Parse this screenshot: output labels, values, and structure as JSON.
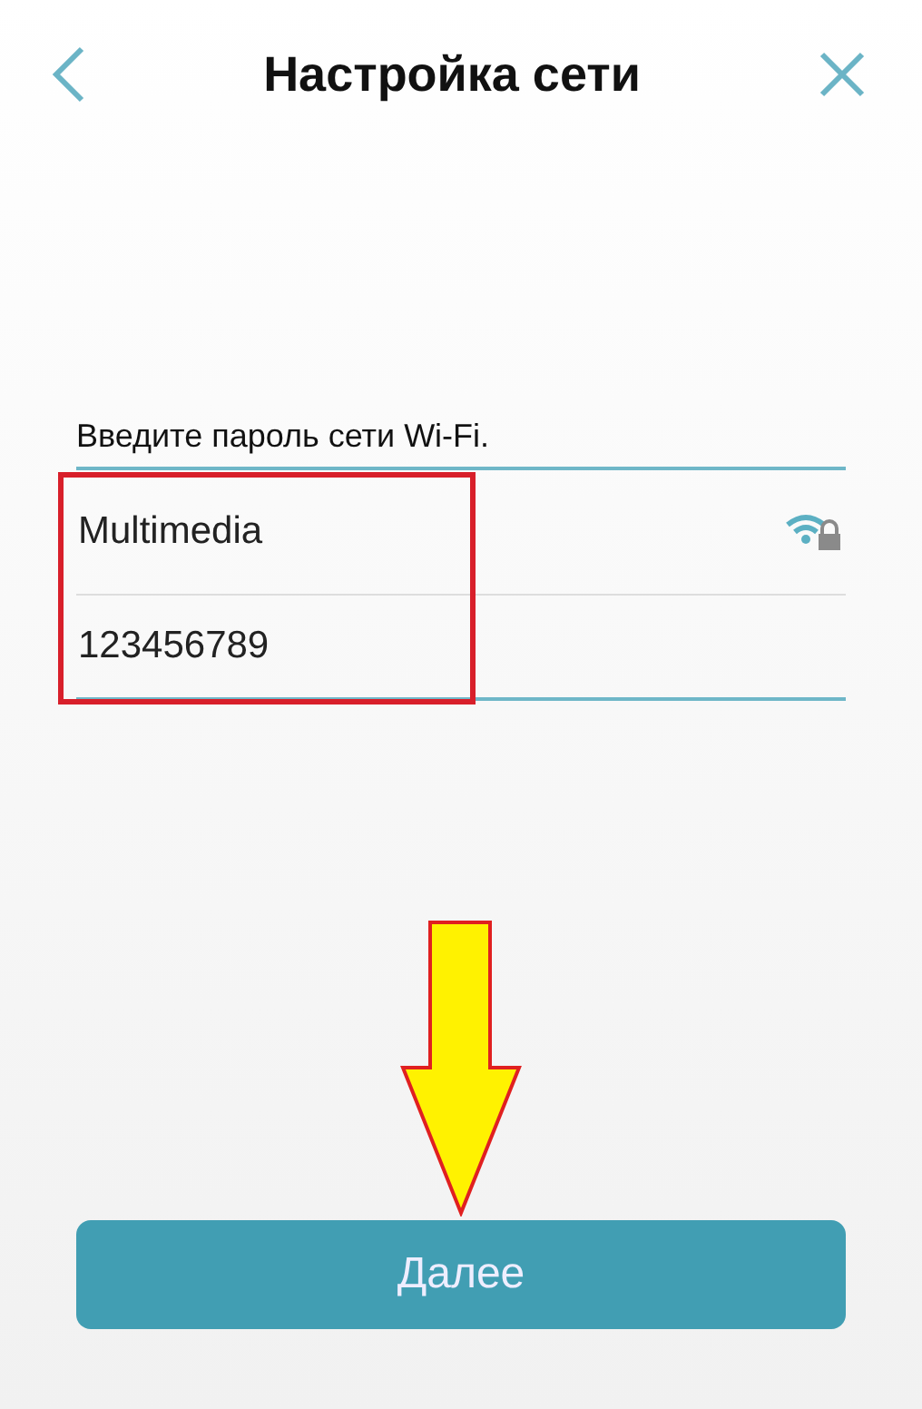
{
  "header": {
    "title": "Настройка сети"
  },
  "form": {
    "prompt": "Введите пароль сети Wi-Fi.",
    "network": {
      "name": "Multimedia",
      "secured": true
    },
    "password": {
      "value": "123456789"
    }
  },
  "annotations": {
    "highlight": true,
    "arrow": true
  },
  "buttons": [
    {
      "label": "Далее"
    }
  ]
}
